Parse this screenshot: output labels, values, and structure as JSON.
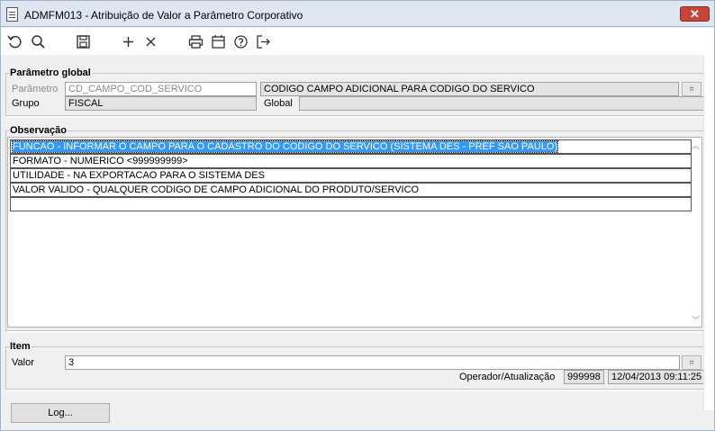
{
  "window": {
    "title": "ADMFM013 - Atribuição de Valor a Parâmetro Corporativo",
    "close_label": "✕"
  },
  "toolbar": {
    "icons": [
      "undo-icon",
      "search-icon",
      "save-icon",
      "add-icon",
      "delete-icon",
      "print-icon",
      "calendar-icon",
      "help-icon",
      "exit-icon"
    ]
  },
  "parametro_global": {
    "legend": "Parâmetro global",
    "parametro_label": "Parâmetro",
    "parametro_value": "CD_CAMPO_COD_SERVICO",
    "descricao_value": "CODIGO CAMPO ADICIONAL PARA CODIGO DO SERVICO",
    "grupo_label": "Grupo",
    "grupo_value": "FISCAL",
    "global_label": "Global",
    "global_value": ""
  },
  "observacao": {
    "legend": "Observação",
    "lines": [
      "FUNCAO - INFORMAR O CAMPO PARA O CADASTRO DO CODIGO DO SERVICO (SISTEMA DES - PREF SAO PAULO)",
      "FORMATO - NUMERICO <999999999>",
      "UTILIDADE - NA EXPORTACAO PARA O SISTEMA DES",
      "VALOR VALIDO - QUALQUER CODIGO DE CAMPO ADICIONAL DO PRODUTO/SERVICO",
      ""
    ]
  },
  "item": {
    "legend": "Item",
    "valor_label": "Valor",
    "valor_value": "3",
    "operador_label": "Operador/Atualização",
    "operador_value": "999998",
    "atualizacao_value": "12/04/2013 09:11:25"
  },
  "log_button": "Log..."
}
